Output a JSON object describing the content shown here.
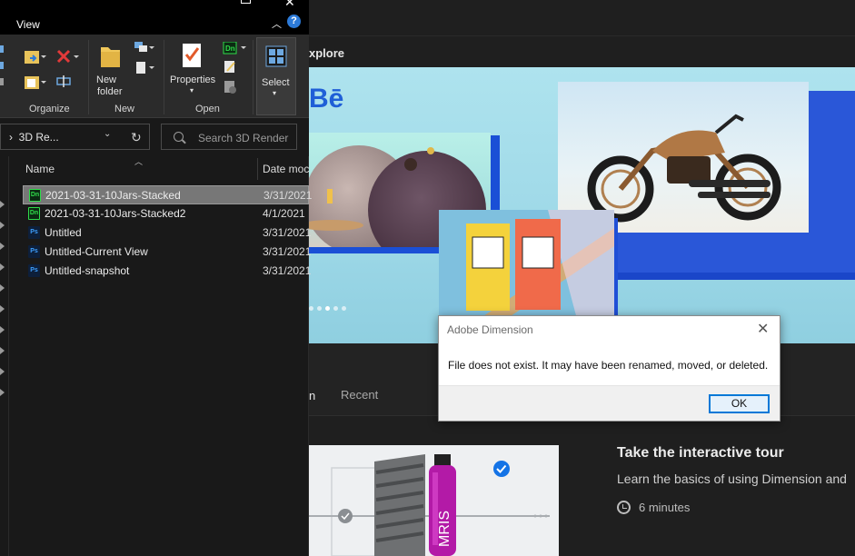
{
  "explorer": {
    "ribbon": {
      "tab_label": "View",
      "groups": {
        "organize": "Organize",
        "new": "New",
        "open": "Open"
      },
      "new_folder_line1": "New",
      "new_folder_line2": "folder",
      "properties_label": "Properties",
      "select_label": "Select"
    },
    "address": {
      "path": "3D Re...",
      "search_placeholder": "Search 3D Render"
    },
    "columns": {
      "name": "Name",
      "date": "Date moc"
    },
    "files": [
      {
        "name": "2021-03-31-10Jars-Stacked",
        "type": "Dn",
        "date": "3/31/2021",
        "selected": true
      },
      {
        "name": "2021-03-31-10Jars-Stacked2",
        "type": "Dn",
        "date": "4/1/2021",
        "selected": false
      },
      {
        "name": "Untitled",
        "type": "Ps",
        "date": "3/31/2021",
        "selected": false
      },
      {
        "name": "Untitled-Current View",
        "type": "Ps",
        "date": "3/31/2021",
        "selected": false
      },
      {
        "name": "Untitled-snapshot",
        "type": "Ps",
        "date": "3/31/2021",
        "selected": false
      }
    ]
  },
  "dimension": {
    "explore_label": "xplore",
    "behance_logo": "Bē",
    "tabs": {
      "home": "n",
      "recent": "Recent"
    },
    "tour": {
      "title": "Take the interactive tour",
      "subtitle": "Learn the basics of using Dimension and",
      "duration": "6 minutes"
    },
    "product_label": "MRIS"
  },
  "dialog": {
    "title": "Adobe Dimension",
    "message": "File does not exist. It may have been renamed, moved, or deleted.",
    "ok_label": "OK"
  },
  "colors": {
    "accent_blue": "#0078d7",
    "behance_blue": "#1f5fd7",
    "dn_green": "#2fdc4a",
    "ps_blue": "#3ea0ff"
  }
}
